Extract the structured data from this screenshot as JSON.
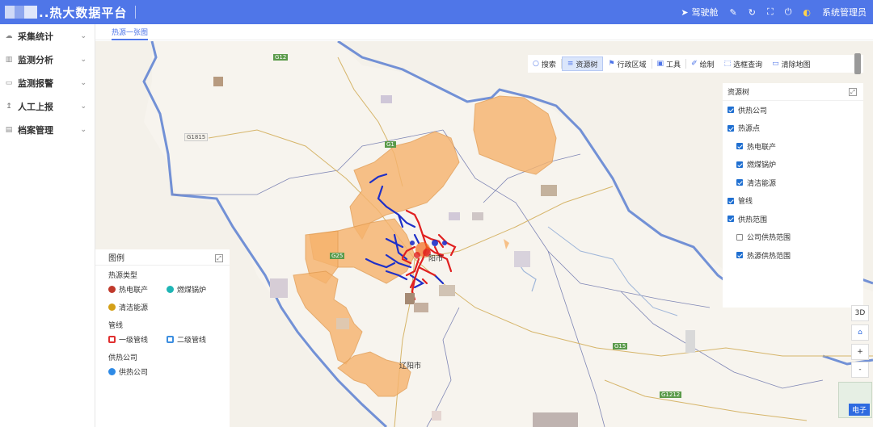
{
  "header": {
    "title": "..热大数据平台",
    "cockpit_label": "驾驶舱",
    "user_label": "系统管理员",
    "colors": {
      "bar": "#4f76e8"
    }
  },
  "sidebar": {
    "items": [
      {
        "label": "采集统计",
        "icon": "cloud-icon"
      },
      {
        "label": "监测分析",
        "icon": "bar-chart-icon"
      },
      {
        "label": "监测报警",
        "icon": "monitor-icon"
      },
      {
        "label": "人工上报",
        "icon": "upload-icon"
      },
      {
        "label": "档案管理",
        "icon": "archive-icon"
      }
    ]
  },
  "tabs": [
    {
      "label": "热源一张图",
      "active": true
    }
  ],
  "toolbar": {
    "search": "搜索",
    "resource_tree": "资源树",
    "admin_region": "行政区域",
    "tools": "工具",
    "draw": "绘制",
    "box_query": "选框查询",
    "clear_map": "清除地图"
  },
  "resource_tree": {
    "title": "资源树",
    "nodes": [
      {
        "label": "供热公司",
        "checked": true,
        "level": 0
      },
      {
        "label": "热源点",
        "checked": true,
        "level": 0
      },
      {
        "label": "热电联产",
        "checked": true,
        "level": 1
      },
      {
        "label": "燃煤锅炉",
        "checked": true,
        "level": 1
      },
      {
        "label": "清洁能源",
        "checked": true,
        "level": 1
      },
      {
        "label": "管线",
        "checked": true,
        "level": 0
      },
      {
        "label": "供热范围",
        "checked": true,
        "level": 0
      },
      {
        "label": "公司供热范围",
        "checked": false,
        "level": 1
      },
      {
        "label": "热源供热范围",
        "checked": true,
        "level": 1
      }
    ]
  },
  "legend": {
    "title": "图例",
    "heat_source_group": "热源类型",
    "chp": "热电联产",
    "coal_boiler": "燃煤锅炉",
    "clean_energy": "清洁能源",
    "pipeline_group": "管线",
    "primary_pipe": "一级管线",
    "secondary_pipe": "二级管线",
    "company_group": "供热公司",
    "company": "供热公司",
    "colors": {
      "chp": "#c0392b",
      "coal": "#1fb5b5",
      "clean": "#d4a017",
      "primary": "#e03030",
      "secondary": "#3c8ee0",
      "company": "#2e8ae6"
    }
  },
  "map": {
    "labels": {
      "city": "阳市",
      "south_city": "辽阳市",
      "road_g15": "G15",
      "road_g12": "G12",
      "road_g1": "G1",
      "road_g1212": "G1212",
      "road_g25": "G25",
      "road_g1815": "G1815"
    },
    "controls": {
      "three_d": "3D",
      "home": "home-icon",
      "zoom_in": "+",
      "zoom_out": "-"
    },
    "basemap": "电子"
  }
}
